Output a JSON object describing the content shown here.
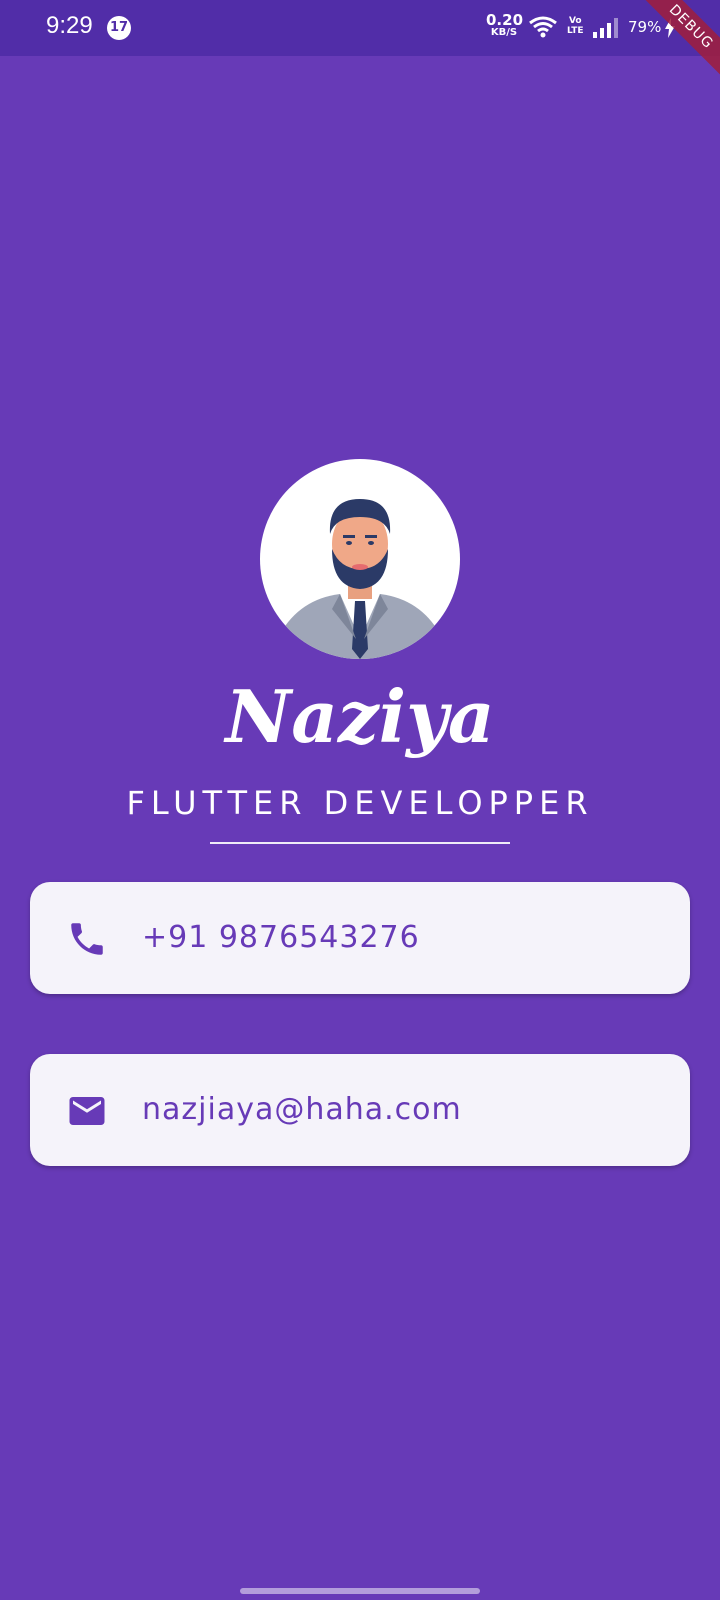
{
  "status_bar": {
    "time": "9:29",
    "notification_count": "17",
    "net_speed_value": "0.20",
    "net_speed_unit": "KB/S",
    "volte_top": "Vo",
    "volte_bottom": "LTE",
    "battery": "79%"
  },
  "debug_banner": "DEBUG",
  "profile": {
    "name": "Naziya",
    "title": "FLUTTER DEVELOPPER",
    "avatar_icon": "person-avatar"
  },
  "contacts": {
    "phone": {
      "icon": "phone-icon",
      "value": "+91 9876543276"
    },
    "email": {
      "icon": "mail-icon",
      "value": "nazjiaya@haha.com"
    }
  },
  "colors": {
    "background": "#673AB7",
    "status_bar": "#512DA8",
    "card": "#F5F3FA",
    "accent": "#673AB7"
  }
}
